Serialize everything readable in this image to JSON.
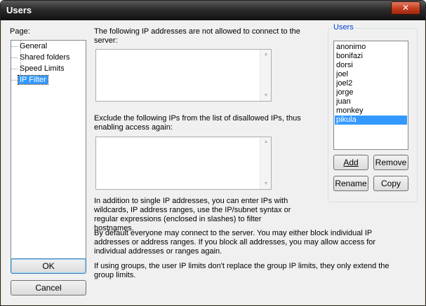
{
  "window": {
    "title": "Users",
    "close_glyph": "✕"
  },
  "page_label": "Page:",
  "tree": {
    "items": [
      {
        "label": "General"
      },
      {
        "label": "Shared folders"
      },
      {
        "label": "Speed Limits"
      },
      {
        "label": "IP Filter",
        "selected": true
      }
    ]
  },
  "ipfilter": {
    "disallowed_label": "The following IP addresses are not allowed to connect to the server:",
    "disallowed_value": "",
    "exclude_label": "Exclude the following IPs from the list of disallowed IPs, thus enabling access again:",
    "exclude_value": "",
    "help1": "In addition to single IP addresses, you can enter IPs with wildcards, IP address ranges, use the IP/subnet syntax or regular expressions (enclosed in slashes) to filter hostnames.",
    "help2": "By default everyone may connect to the server. You may either block individual IP addresses or address ranges. If you block all addresses, you may allow access for individual addresses or ranges again.",
    "help3": "If using groups, the user IP limits don't replace the group IP limits, they only extend the group limits."
  },
  "users_panel": {
    "legend": "Users",
    "users": [
      "anonimo",
      "bonifazi",
      "dorsi",
      "joel",
      "joel2",
      "jorge",
      "juan",
      "monkey",
      "pikula"
    ],
    "selected_user": "pikula",
    "add_label": "Add",
    "remove_label": "Remove",
    "rename_label": "Rename",
    "copy_label": "Copy"
  },
  "buttons": {
    "ok_label": "OK",
    "cancel_label": "Cancel"
  },
  "scroll": {
    "up_glyph": "▲",
    "down_glyph": "▼"
  }
}
